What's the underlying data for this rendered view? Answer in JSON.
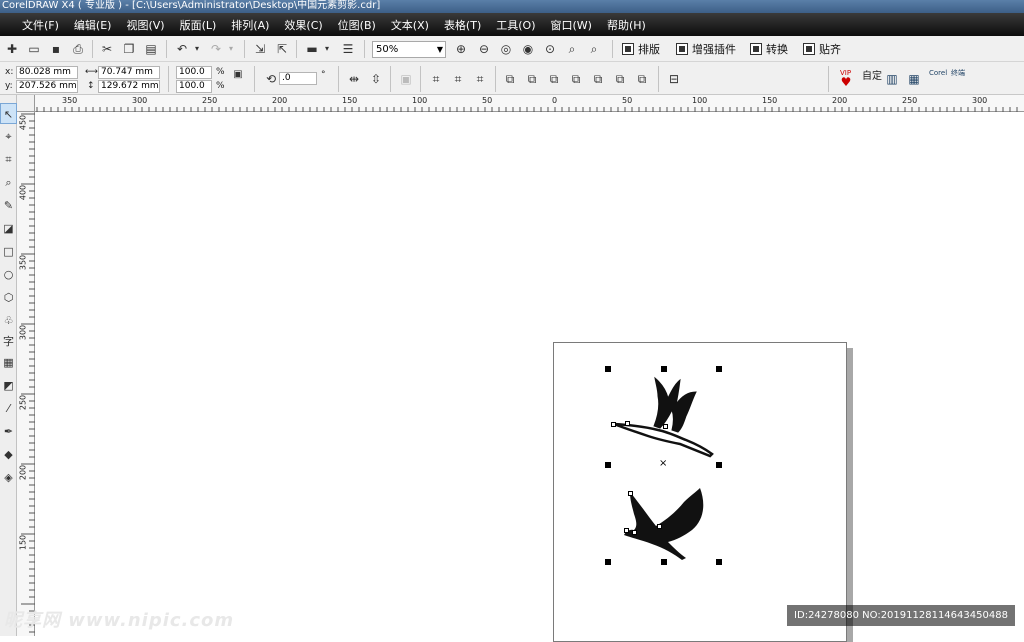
{
  "window": {
    "title": "CorelDRAW X4 ( 专业版 ) - [C:\\Users\\Administrator\\Desktop\\中国元素剪影.cdr]"
  },
  "menu": [
    "文件(F)",
    "编辑(E)",
    "视图(V)",
    "版面(L)",
    "排列(A)",
    "效果(C)",
    "位图(B)",
    "文本(X)",
    "表格(T)",
    "工具(O)",
    "窗口(W)",
    "帮助(H)"
  ],
  "standard_toolbar": {
    "zoom_level": "50%",
    "plugins": {
      "paiban": "排版",
      "zengqiang": "增强插件",
      "zhuanhuan": "转换",
      "tieqi": "贴齐"
    }
  },
  "property_bar": {
    "x_label": "x:",
    "x_value": "80.028 mm",
    "y_label": "y:",
    "y_value": "207.526 mm",
    "width_value": "70.747 mm",
    "height_value": "129.672 mm",
    "scale_x": "100.0",
    "scale_y": "100.0",
    "percent": "%",
    "rotation": ".0",
    "degree": "°",
    "vip_label": "VIP",
    "custom_label": "自定",
    "corel_label": "Corel",
    "extra_label": "终端"
  },
  "ruler": {
    "h_ticks": [
      "350",
      "300",
      "250",
      "200",
      "150",
      "100",
      "50",
      "0",
      "50",
      "100",
      "150",
      "200",
      "250",
      "300"
    ],
    "v_ticks": [
      "450",
      "400",
      "350",
      "300",
      "250",
      "200",
      "150"
    ]
  },
  "toolbox": {
    "text_tool": "字"
  },
  "center_mark": "×",
  "watermark": {
    "left": "昵享网 www.nipic.com",
    "right": "ID:24278080 NO:20191128114643450488"
  },
  "colors": {
    "menubar": "#1a1a1a",
    "titlebar": "#3d5f87",
    "page_border": "#7a7a7a"
  }
}
